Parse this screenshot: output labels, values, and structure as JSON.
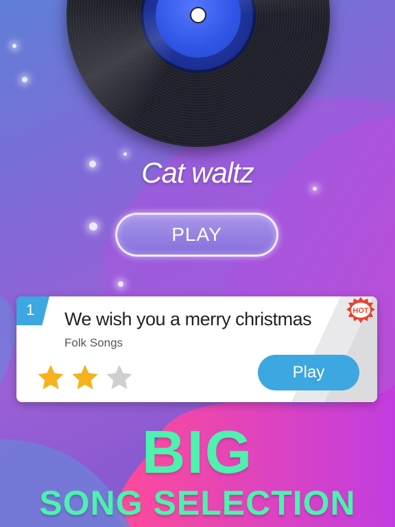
{
  "now_playing": {
    "song_title": "Cat waltz",
    "play_label": "PLAY"
  },
  "song_card": {
    "rank": "1",
    "title": "We wish you a merry christmas",
    "category": "Folk Songs",
    "badge": "HOT",
    "rating": 2,
    "max_rating": 3,
    "play_label": "Play"
  },
  "promo": {
    "line1": "BIG",
    "line2": "SONG SELECTION"
  },
  "colors": {
    "accent_blue": "#3ca7e0",
    "promo_green": "#4cf2ad",
    "star_gold": "#f5b21c",
    "star_gray": "#cfcfcf",
    "hot_red": "#e8432c"
  }
}
